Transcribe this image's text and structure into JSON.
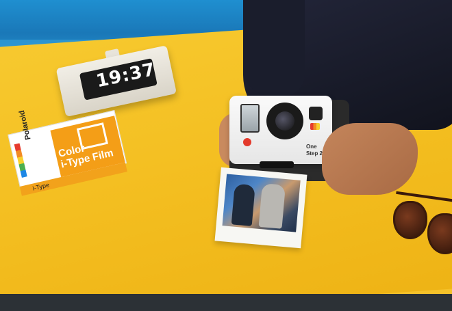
{
  "clock": {
    "time": "19:37"
  },
  "film_box": {
    "brand": "Polaroid",
    "product_line1": "Color",
    "product_line2": "i-Type Film",
    "type_label": "i-Type"
  },
  "camera": {
    "model_line1": "One",
    "model_line2": "Step 2"
  },
  "colors": {
    "table": "#f5c22a",
    "wall": "#1f8fd0",
    "film_orange": "#f49e17",
    "shutter_red": "#e33a2c"
  }
}
